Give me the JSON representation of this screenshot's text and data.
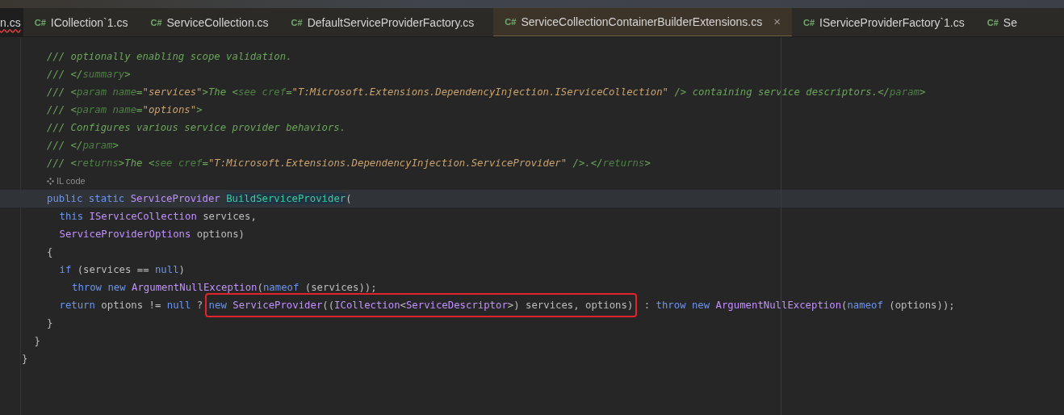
{
  "tabs": [
    {
      "label": "n.cs",
      "selected": false,
      "error": true,
      "closable": false
    },
    {
      "label": "ICollection`1.cs",
      "icon_text": "C#",
      "selected": false,
      "error": false,
      "closable": false
    },
    {
      "label": "ServiceCollection.cs",
      "icon_text": "C#",
      "selected": false,
      "error": false,
      "closable": false
    },
    {
      "label": "DefaultServiceProviderFactory.cs",
      "icon_text": "C#",
      "selected": false,
      "error": false,
      "closable": false
    },
    {
      "label": "ServiceCollectionContainerBuilderExtensions.cs",
      "icon_text": "C#",
      "selected": true,
      "error": false,
      "closable": true,
      "close_text": "×"
    },
    {
      "label": "IServiceProviderFactory`1.cs",
      "icon_text": "C#",
      "selected": false,
      "error": false,
      "closable": false
    },
    {
      "label": "Se",
      "icon_text": "C#",
      "selected": false,
      "error": false,
      "closable": false
    }
  ],
  "code": [
    {
      "kind": "group",
      "children": [
        {
          "kind": "group",
          "children": [
            {
              "kind": "code",
              "current": false,
              "segments": [
                {
                  "boxed": false,
                  "tokens": [
                    {
                      "kind": "comment",
                      "text": "/// optionally enabling scope validation."
                    }
                  ]
                }
              ]
            },
            {
              "kind": "code",
              "current": false,
              "segments": [
                {
                  "boxed": false,
                  "tokens": [
                    {
                      "kind": "comment",
                      "text": "/// </"
                    },
                    {
                      "kind": "doc_tag",
                      "text": "summary"
                    },
                    {
                      "kind": "comment",
                      "text": ">"
                    }
                  ]
                }
              ]
            },
            {
              "kind": "code",
              "current": false,
              "segments": [
                {
                  "boxed": false,
                  "tokens": [
                    {
                      "kind": "comment",
                      "text": "/// <"
                    },
                    {
                      "kind": "doc_tag",
                      "text": "param name"
                    },
                    {
                      "kind": "comment",
                      "text": "="
                    },
                    {
                      "kind": "doc_string",
                      "text": "\"services\""
                    },
                    {
                      "kind": "comment",
                      "text": ">The <"
                    },
                    {
                      "kind": "doc_tag",
                      "text": "see cref"
                    },
                    {
                      "kind": "comment",
                      "text": "="
                    },
                    {
                      "kind": "doc_string",
                      "text": "\"T:Microsoft.Extensions.DependencyInjection.IServiceCollection\""
                    },
                    {
                      "kind": "comment",
                      "text": " /> containing service descriptors.</"
                    },
                    {
                      "kind": "doc_tag",
                      "text": "param"
                    },
                    {
                      "kind": "comment",
                      "text": ">"
                    }
                  ]
                }
              ]
            },
            {
              "kind": "code",
              "current": false,
              "segments": [
                {
                  "boxed": false,
                  "tokens": [
                    {
                      "kind": "comment",
                      "text": "/// <"
                    },
                    {
                      "kind": "doc_tag",
                      "text": "param name"
                    },
                    {
                      "kind": "comment",
                      "text": "="
                    },
                    {
                      "kind": "doc_string",
                      "text": "\"options\""
                    },
                    {
                      "kind": "comment",
                      "text": ">"
                    }
                  ]
                }
              ]
            },
            {
              "kind": "code",
              "current": false,
              "segments": [
                {
                  "boxed": false,
                  "tokens": [
                    {
                      "kind": "comment",
                      "text": "/// Configures various service provider behaviors."
                    }
                  ]
                }
              ]
            },
            {
              "kind": "code",
              "current": false,
              "segments": [
                {
                  "boxed": false,
                  "tokens": [
                    {
                      "kind": "comment",
                      "text": "/// </"
                    },
                    {
                      "kind": "doc_tag",
                      "text": "param"
                    },
                    {
                      "kind": "comment",
                      "text": ">"
                    }
                  ]
                }
              ]
            },
            {
              "kind": "code",
              "current": false,
              "segments": [
                {
                  "boxed": false,
                  "tokens": [
                    {
                      "kind": "comment",
                      "text": "/// <"
                    },
                    {
                      "kind": "doc_tag",
                      "text": "returns"
                    },
                    {
                      "kind": "comment",
                      "text": ">The <"
                    },
                    {
                      "kind": "doc_tag",
                      "text": "see cref"
                    },
                    {
                      "kind": "comment",
                      "text": "="
                    },
                    {
                      "kind": "doc_string",
                      "text": "\"T:Microsoft.Extensions.DependencyInjection.ServiceProvider\""
                    },
                    {
                      "kind": "comment",
                      "text": " />.</"
                    },
                    {
                      "kind": "doc_tag",
                      "text": "returns"
                    },
                    {
                      "kind": "comment",
                      "text": ">"
                    }
                  ]
                }
              ]
            },
            {
              "kind": "hint",
              "text": "IL code"
            },
            {
              "kind": "code",
              "current": true,
              "segments": [
                {
                  "boxed": false,
                  "tokens": [
                    {
                      "kind": "keyword",
                      "text": "public static "
                    },
                    {
                      "kind": "type",
                      "text": "ServiceProvider "
                    },
                    {
                      "kind": "method_highlighted",
                      "text": "BuildServiceProvider"
                    },
                    {
                      "kind": "plain",
                      "text": "("
                    }
                  ]
                }
              ],
              "children": [
                {
                  "kind": "code",
                  "current": false,
                  "segments": [
                    {
                      "boxed": false,
                      "tokens": [
                        {
                          "kind": "keyword",
                          "text": "this "
                        },
                        {
                          "kind": "type",
                          "text": "IServiceCollection"
                        },
                        {
                          "kind": "plain",
                          "text": " services,"
                        }
                      ]
                    }
                  ]
                },
                {
                  "kind": "code",
                  "current": false,
                  "segments": [
                    {
                      "boxed": false,
                      "tokens": [
                        {
                          "kind": "type",
                          "text": "ServiceProviderOptions"
                        },
                        {
                          "kind": "plain",
                          "text": " options)"
                        }
                      ]
                    }
                  ]
                }
              ]
            },
            {
              "kind": "code",
              "current": false,
              "segments": [
                {
                  "boxed": false,
                  "tokens": [
                    {
                      "kind": "plain",
                      "text": "{"
                    }
                  ]
                }
              ],
              "children": [
                {
                  "kind": "code",
                  "current": false,
                  "segments": [
                    {
                      "boxed": false,
                      "tokens": [
                        {
                          "kind": "keyword",
                          "text": "if "
                        },
                        {
                          "kind": "plain",
                          "text": "(services == "
                        },
                        {
                          "kind": "keyword",
                          "text": "null"
                        },
                        {
                          "kind": "plain",
                          "text": ")"
                        }
                      ]
                    }
                  ],
                  "children": [
                    {
                      "kind": "code",
                      "current": false,
                      "segments": [
                        {
                          "boxed": false,
                          "tokens": [
                            {
                              "kind": "keyword",
                              "text": "throw new "
                            },
                            {
                              "kind": "type",
                              "text": "ArgumentNullException"
                            },
                            {
                              "kind": "plain",
                              "text": "("
                            },
                            {
                              "kind": "keyword",
                              "text": "nameof"
                            },
                            {
                              "kind": "plain",
                              "text": " (services));"
                            }
                          ]
                        }
                      ]
                    }
                  ]
                },
                {
                  "kind": "code",
                  "current": false,
                  "segments": [
                    {
                      "boxed": false,
                      "tokens": [
                        {
                          "kind": "keyword",
                          "text": "return "
                        },
                        {
                          "kind": "plain",
                          "text": "options != "
                        },
                        {
                          "kind": "keyword",
                          "text": "null"
                        },
                        {
                          "kind": "plain",
                          "text": " ? "
                        }
                      ]
                    },
                    {
                      "boxed": true,
                      "tokens": [
                        {
                          "kind": "keyword",
                          "text": "new "
                        },
                        {
                          "kind": "type",
                          "text": "ServiceProvider"
                        },
                        {
                          "kind": "plain",
                          "text": "(("
                        },
                        {
                          "kind": "type",
                          "text": "ICollection"
                        },
                        {
                          "kind": "plain",
                          "text": "<"
                        },
                        {
                          "kind": "type",
                          "text": "ServiceDescriptor"
                        },
                        {
                          "kind": "plain",
                          "text": ">) services, options)"
                        }
                      ]
                    },
                    {
                      "boxed": false,
                      "tokens": [
                        {
                          "kind": "plain",
                          "text": " : "
                        },
                        {
                          "kind": "keyword",
                          "text": "throw new "
                        },
                        {
                          "kind": "type",
                          "text": "ArgumentNullException"
                        },
                        {
                          "kind": "plain",
                          "text": "("
                        },
                        {
                          "kind": "keyword",
                          "text": "nameof"
                        },
                        {
                          "kind": "plain",
                          "text": " (options));"
                        }
                      ]
                    }
                  ]
                }
              ]
            },
            {
              "kind": "code",
              "current": false,
              "segments": [
                {
                  "boxed": false,
                  "tokens": [
                    {
                      "kind": "plain",
                      "text": "}"
                    }
                  ]
                }
              ]
            }
          ]
        },
        {
          "kind": "code",
          "current": false,
          "segments": [
            {
              "boxed": false,
              "tokens": [
                {
                  "kind": "plain",
                  "text": "}"
                }
              ]
            }
          ]
        }
      ]
    },
    {
      "kind": "code",
      "current": false,
      "segments": [
        {
          "boxed": false,
          "tokens": [
            {
              "kind": "plain",
              "text": "}"
            }
          ]
        }
      ]
    }
  ]
}
